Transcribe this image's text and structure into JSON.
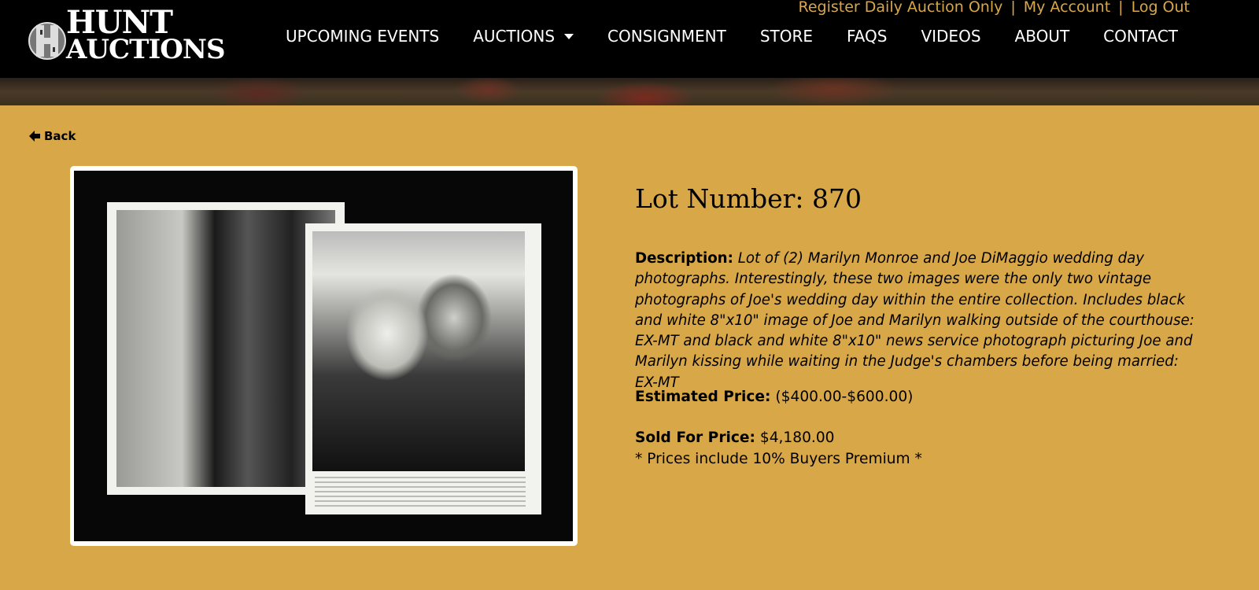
{
  "header": {
    "logo": {
      "line1": "HUNT",
      "line2": "AUCTIONS",
      "icon": "hunt-auctions-monogram"
    },
    "top_links": [
      "Register Daily Auction Only",
      "My Account",
      "Log Out"
    ],
    "top_links_separator": "|",
    "nav": [
      {
        "label": "UPCOMING EVENTS"
      },
      {
        "label": "AUCTIONS",
        "has_dropdown": true
      },
      {
        "label": "CONSIGNMENT"
      },
      {
        "label": "STORE"
      },
      {
        "label": "FAQS"
      },
      {
        "label": "VIDEOS"
      },
      {
        "label": "ABOUT"
      },
      {
        "label": "CONTACT"
      }
    ]
  },
  "back_label": "Back",
  "lot": {
    "title": "Lot Number: 870",
    "description_label": "Description:",
    "description": "Lot of (2) Marilyn Monroe and Joe DiMaggio wedding day photographs. Interestingly, these two images were the only two vintage photographs of Joe's wedding day within the entire collection. Includes black and white 8\"x10\" image of Joe and Marilyn walking outside of the courthouse: EX-MT and black and white 8\"x10\" news service photograph picturing Joe and Marilyn kissing while waiting in the Judge's chambers before being married: EX-MT",
    "estimated_label": "Estimated Price:",
    "estimated_value": "($400.00-$600.00)",
    "sold_label": "Sold For Price:",
    "sold_value": "$4,180.00",
    "premium_note": "* Prices include 10% Buyers Premium *"
  },
  "colors": {
    "page_background": "#d8a748",
    "header_background": "#000000",
    "top_link_color": "#d8a748"
  }
}
